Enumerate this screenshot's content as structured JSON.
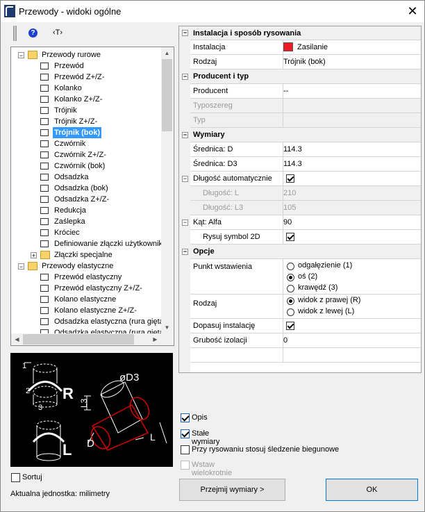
{
  "window": {
    "title": "Przewody - widoki ogólne",
    "close_glyph": "✕"
  },
  "toolbar": {
    "help_glyph": "?",
    "text_tool": "‹T›"
  },
  "tree": {
    "groups": [
      {
        "label": "Przewody rurowe",
        "expander": "−",
        "items": [
          {
            "label": "Przewód",
            "icon": "pipe-straight-icon"
          },
          {
            "label": "Przewód Z+/Z-",
            "icon": "pipe-vertical-icon"
          },
          {
            "label": "Kolanko",
            "icon": "elbow-icon"
          },
          {
            "label": "Kolanko Z+/Z-",
            "icon": "elbow-vertical-icon"
          },
          {
            "label": "Trójnik",
            "icon": "tee-icon"
          },
          {
            "label": "Trójnik Z+/Z-",
            "icon": "tee-vertical-icon"
          },
          {
            "label": "Trójnik (bok)",
            "icon": "tee-side-icon",
            "selected": true
          },
          {
            "label": "Czwórnik",
            "icon": "cross-icon"
          },
          {
            "label": "Czwórnik Z+/Z-",
            "icon": "cross-vertical-icon"
          },
          {
            "label": "Czwórnik (bok)",
            "icon": "cross-side-icon"
          },
          {
            "label": "Odsadzka",
            "icon": "offset-icon"
          },
          {
            "label": "Odsadzka (bok)",
            "icon": "offset-side-icon"
          },
          {
            "label": "Odsadzka Z+/Z-",
            "icon": "offset-vertical-icon"
          },
          {
            "label": "Redukcja",
            "icon": "reducer-icon"
          },
          {
            "label": "Zaślepka",
            "icon": "cap-icon"
          },
          {
            "label": "Króciec",
            "icon": "stub-icon"
          },
          {
            "label": "Definiowanie złączki użytkownika",
            "icon": "custom-fitting-icon"
          },
          {
            "label": "Złączki specjalne",
            "icon": "folder-icon",
            "expander": "+"
          }
        ]
      },
      {
        "label": "Przewody elastyczne",
        "expander": "−",
        "items": [
          {
            "label": "Przewód elastyczny",
            "icon": "flex-pipe-icon"
          },
          {
            "label": "Przewód elastyczny Z+/Z-",
            "icon": "flex-pipe-vertical-icon"
          },
          {
            "label": "Kolano elastyczne",
            "icon": "flex-elbow-icon"
          },
          {
            "label": "Kolano elastyczne Z+/Z-",
            "icon": "flex-elbow-vertical-icon"
          },
          {
            "label": "Odsadzka elastyczna (rura gięta)",
            "icon": "flex-offset-icon"
          },
          {
            "label": "Odsadzka elastyczna (rura gięta)",
            "icon": "flex-offset-side-icon"
          }
        ]
      }
    ],
    "scroll_up": "▲",
    "scroll_down": "▼",
    "scroll_left": "◀",
    "scroll_right": "▶"
  },
  "preview": {
    "label_r": "R",
    "label_l": "L",
    "dim_d3": "øD3",
    "dim_l3": "L3",
    "dim_d": "D",
    "dim_l": "L",
    "dim_1": "1",
    "dim_2": "2",
    "dim_3": "3"
  },
  "sort": {
    "label": "Sortuj",
    "checked": false
  },
  "unit_text": "Aktualna jednostka: milimetry",
  "props": {
    "cat1": {
      "title": "Instalacja i sposób rysowania",
      "toggle": "−"
    },
    "instalacja": {
      "name": "Instalacja",
      "value": "Zasilanie",
      "color": "#ed1c24"
    },
    "rodzaj1": {
      "name": "Rodzaj",
      "value": "Trójnik (bok)"
    },
    "cat2": {
      "title": "Producent i typ",
      "toggle": "−"
    },
    "producent": {
      "name": "Producent",
      "value": "--"
    },
    "typoszereg": {
      "name": "Typoszereg",
      "value": ""
    },
    "typ": {
      "name": "Typ",
      "value": ""
    },
    "cat3": {
      "title": "Wymiary",
      "toggle": "−"
    },
    "srednica_d": {
      "name": "Średnica: D",
      "value": "114.3"
    },
    "srednica_d3": {
      "name": "Średnica: D3",
      "value": "114.3"
    },
    "dlugosc_auto": {
      "name": "Długość automatycznie",
      "checked": true,
      "toggle": "−"
    },
    "dlugosc_l": {
      "name": "Długość: L",
      "value": "210"
    },
    "dlugosc_l3": {
      "name": "Długość: L3",
      "value": "105"
    },
    "kat_alfa": {
      "name": "Kąt: Alfa",
      "value": "90",
      "toggle": "−"
    },
    "rysuj_2d": {
      "name": "Rysuj symbol 2D",
      "checked": true
    },
    "cat4": {
      "title": "Opcje",
      "toggle": "−"
    },
    "punkt": {
      "name": "Punkt wstawienia",
      "options": [
        "odgałęzienie (1)",
        "oś (2)",
        "krawędź (3)"
      ],
      "selected": 1
    },
    "rodzaj2": {
      "name": "Rodzaj",
      "options": [
        "widok z prawej (R)",
        "widok z lewej (L)"
      ],
      "selected": 0
    },
    "dopasuj": {
      "name": "Dopasuj instalację",
      "checked": true
    },
    "grubosc": {
      "name": "Grubość izolacji",
      "value": "0"
    }
  },
  "options": {
    "opis": {
      "label": "Opis",
      "checked": true
    },
    "stale": {
      "label": "Stałe wymiary",
      "checked": true
    },
    "sledzenie": {
      "label": "Przy rysowaniu stosuj śledzenie biegunowe",
      "checked": false
    },
    "wielokrotnie": {
      "label": "Wstaw wielokrotnie",
      "checked": false,
      "disabled": true
    }
  },
  "buttons": {
    "przejmij": "Przejmij wymiary >",
    "ok": "OK"
  }
}
